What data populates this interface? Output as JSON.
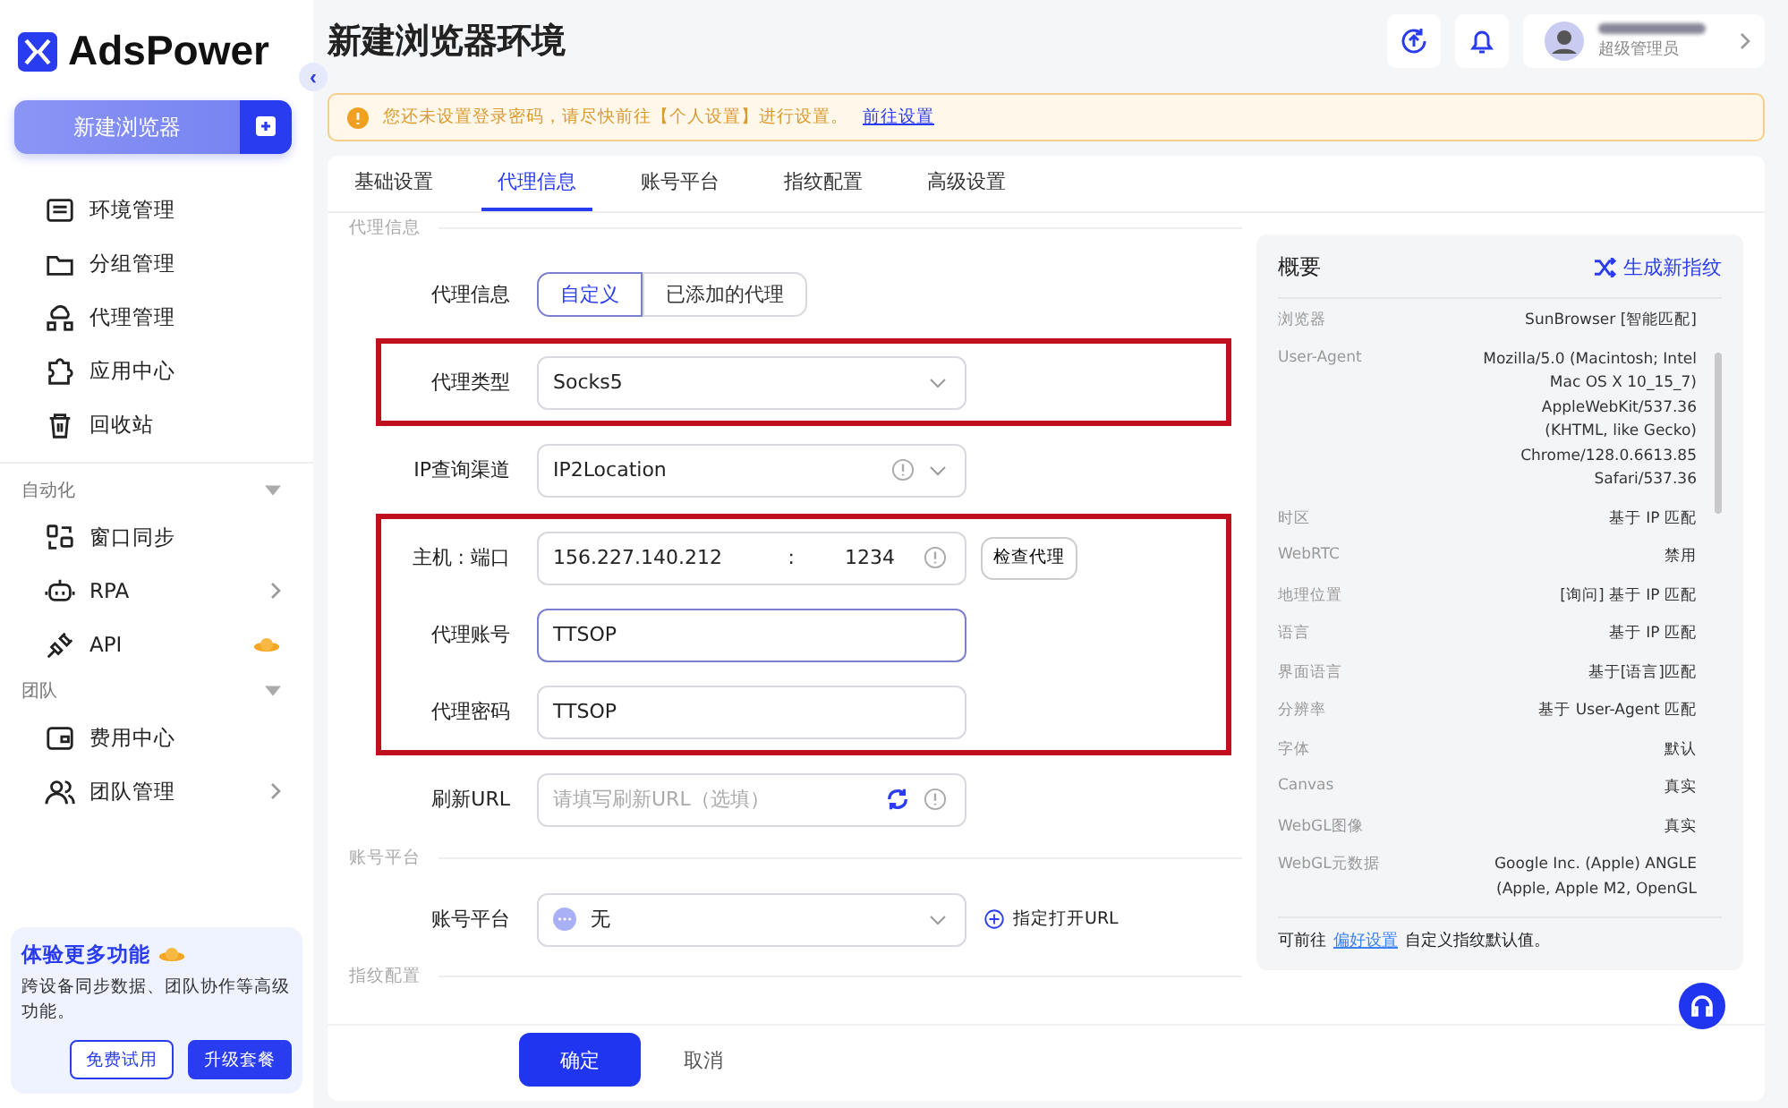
{
  "app": {
    "name": "AdsPower",
    "collapse_icon": "‹"
  },
  "sidebar": {
    "new_button": "新建浏览器",
    "items": [
      {
        "label": "环境管理"
      },
      {
        "label": "分组管理"
      },
      {
        "label": "代理管理"
      },
      {
        "label": "应用中心"
      },
      {
        "label": "回收站"
      }
    ],
    "groups": [
      {
        "title": "自动化",
        "expanded": true,
        "items": [
          {
            "label": "窗口同步",
            "chevron": false,
            "badge": false
          },
          {
            "label": "RPA",
            "chevron": true,
            "badge": false
          },
          {
            "label": "API",
            "chevron": false,
            "badge": true
          }
        ]
      },
      {
        "title": "团队",
        "expanded": true,
        "items": [
          {
            "label": "费用中心",
            "chevron": false,
            "badge": false
          },
          {
            "label": "团队管理",
            "chevron": true,
            "badge": false
          }
        ]
      }
    ],
    "promo": {
      "title": "体验更多功能",
      "text": "跨设备同步数据、团队协作等高级功能。",
      "buttons": [
        {
          "label": "免费试用",
          "primary": false
        },
        {
          "label": "升级套餐",
          "primary": true
        }
      ]
    }
  },
  "header": {
    "title": "新建浏览器环境",
    "user_role": "超级管理员"
  },
  "notice": {
    "text": "您还未设置登录密码，请尽快前往【个人设置】进行设置。",
    "link": "前往设置"
  },
  "tabs": [
    {
      "label": "基础设置",
      "selected": false
    },
    {
      "label": "代理信息",
      "selected": true
    },
    {
      "label": "账号平台",
      "selected": false
    },
    {
      "label": "指纹配置",
      "selected": false
    },
    {
      "label": "高级设置",
      "selected": false
    }
  ],
  "form": {
    "section": "代理信息",
    "groups": [
      {
        "highlighted": false,
        "rows": [
          {
            "kind": "segmented",
            "label": "代理信息",
            "options": [
              {
                "label": "自定义",
                "selected": true
              },
              {
                "label": "已添加的代理",
                "selected": false
              }
            ]
          }
        ]
      },
      {
        "highlighted": true,
        "rows": [
          {
            "kind": "select",
            "label": "代理类型",
            "value": "Socks5",
            "info": false
          }
        ]
      },
      {
        "highlighted": false,
        "rows": [
          {
            "kind": "select",
            "label": "IP查询渠道",
            "value": "IP2Location",
            "info": true
          }
        ]
      },
      {
        "highlighted": true,
        "rows": [
          {
            "kind": "hostport",
            "label": "主机 : 端口",
            "host": "156.227.140.212",
            "separator": ":",
            "port": "1234",
            "action": "检查代理"
          },
          {
            "kind": "input",
            "label": "代理账号",
            "value": "TTSOP",
            "focused": true
          },
          {
            "kind": "input",
            "label": "代理密码",
            "value": "TTSOP",
            "focused": false
          }
        ]
      },
      {
        "highlighted": false,
        "rows": [
          {
            "kind": "refresh",
            "label": "刷新URL",
            "placeholder": "请填写刷新URL（选填）"
          }
        ]
      }
    ],
    "platform_section": "账号平台",
    "platform": {
      "label": "账号平台",
      "value": "无",
      "action": "指定打开URL"
    },
    "next_section": "指纹配置"
  },
  "summary": {
    "title": "概要",
    "action": "生成新指纹",
    "rows": [
      {
        "label": "浏览器",
        "lines": [
          "SunBrowser [智能匹配]"
        ]
      },
      {
        "label": "User-Agent",
        "lines": [
          "Mozilla/5.0 (Macintosh; Intel",
          "Mac OS X 10_15_7)",
          "AppleWebKit/537.36",
          "(KHTML, like Gecko)",
          "Chrome/128.0.6613.85",
          "Safari/537.36"
        ]
      },
      {
        "label": "时区",
        "lines": [
          "基于 IP 匹配"
        ]
      },
      {
        "label": "WebRTC",
        "lines": [
          "禁用"
        ]
      },
      {
        "label": "地理位置",
        "lines": [
          "[询问] 基于 IP 匹配"
        ]
      },
      {
        "label": "语言",
        "lines": [
          "基于 IP 匹配"
        ]
      },
      {
        "label": "界面语言",
        "lines": [
          "基于[语言]匹配"
        ]
      },
      {
        "label": "分辨率",
        "lines": [
          "基于 User-Agent 匹配"
        ]
      },
      {
        "label": "字体",
        "lines": [
          "默认"
        ]
      },
      {
        "label": "Canvas",
        "lines": [
          "真实"
        ]
      },
      {
        "label": "WebGL图像",
        "lines": [
          "真实"
        ]
      },
      {
        "label": "WebGL元数据",
        "lines": [
          "Google Inc. (Apple) ANGLE",
          "(Apple, Apple M2, OpenGL"
        ]
      }
    ],
    "footer_prefix": "可前往",
    "footer_link": "偏好设置",
    "footer_suffix": "自定义指纹默认值。"
  },
  "actions": {
    "confirm": "确定",
    "cancel": "取消"
  }
}
